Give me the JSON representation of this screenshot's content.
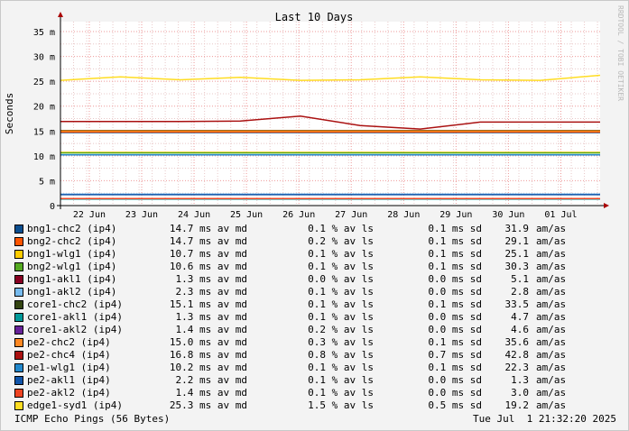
{
  "chart_data": {
    "type": "line",
    "title": "Last 10 Days",
    "ylabel": "Seconds",
    "ylim": [
      0,
      0.037
    ],
    "y_ticks": [
      {
        "value": 0,
        "label": "0"
      },
      {
        "value": 0.005,
        "label": "5 m"
      },
      {
        "value": 0.01,
        "label": "10 m"
      },
      {
        "value": 0.015,
        "label": "15 m"
      },
      {
        "value": 0.02,
        "label": "20 m"
      },
      {
        "value": 0.025,
        "label": "25 m"
      },
      {
        "value": 0.03,
        "label": "30 m"
      },
      {
        "value": 0.035,
        "label": "35 m"
      }
    ],
    "x_ticks": [
      "22 Jun",
      "23 Jun",
      "24 Jun",
      "25 Jun",
      "26 Jun",
      "27 Jun",
      "28 Jun",
      "29 Jun",
      "30 Jun",
      "01 Jul"
    ],
    "grid": true,
    "series": [
      {
        "name": "bng1-chc2 (ip4)",
        "color": "#0b4e8f",
        "median": "14.7 ms av md",
        "loss": "0.1 % av ls",
        "sd": "0.1 ms sd",
        "amas": "31.9",
        "unit": "am/as",
        "values": [
          14.7,
          14.7,
          14.7,
          14.7,
          14.7,
          14.7,
          14.7,
          14.7,
          14.7,
          14.7
        ]
      },
      {
        "name": "bng2-chc2 (ip4)",
        "color": "#ff5500",
        "median": "14.7 ms av md",
        "loss": "0.2 % av ls",
        "sd": "0.1 ms sd",
        "amas": "29.1",
        "unit": "am/as",
        "values": [
          14.8,
          14.8,
          14.8,
          14.8,
          14.8,
          14.8,
          14.8,
          14.8,
          14.8,
          14.8
        ]
      },
      {
        "name": "bng1-wlg1 (ip4)",
        "color": "#ffcc00",
        "median": "10.7 ms av md",
        "loss": "0.1 % av ls",
        "sd": "0.1 ms sd",
        "amas": "25.1",
        "unit": "am/as",
        "values": [
          10.7,
          10.7,
          10.7,
          10.7,
          10.7,
          10.7,
          10.7,
          10.7,
          10.7,
          10.7
        ]
      },
      {
        "name": "bng2-wlg1 (ip4)",
        "color": "#55aa22",
        "median": "10.6 ms av md",
        "loss": "0.1 % av ls",
        "sd": "0.1 ms sd",
        "amas": "30.3",
        "unit": "am/as",
        "values": [
          10.6,
          10.6,
          10.6,
          10.6,
          10.6,
          10.6,
          10.6,
          10.6,
          10.6,
          10.6
        ]
      },
      {
        "name": "bng1-akl1 (ip4)",
        "color": "#880022",
        "median": "1.3 ms av md",
        "loss": "0.0 % av ls",
        "sd": "0.0 ms sd",
        "amas": "5.1",
        "unit": "am/as",
        "values": [
          1.3,
          1.3,
          1.3,
          1.3,
          1.3,
          1.3,
          1.3,
          1.3,
          1.3,
          1.3
        ]
      },
      {
        "name": "bng1-akl2 (ip4)",
        "color": "#77bbee",
        "median": "2.3 ms av md",
        "loss": "0.1 % av ls",
        "sd": "0.0 ms sd",
        "amas": "2.8",
        "unit": "am/as",
        "values": [
          2.3,
          2.3,
          2.3,
          2.3,
          2.3,
          2.3,
          2.3,
          2.3,
          2.3,
          2.3
        ]
      },
      {
        "name": "core1-chc2 (ip4)",
        "color": "#334411",
        "median": "15.1 ms av md",
        "loss": "0.1 % av ls",
        "sd": "0.1 ms sd",
        "amas": "33.5",
        "unit": "am/as",
        "values": [
          15.1,
          15.1,
          15.1,
          15.1,
          15.1,
          15.1,
          15.1,
          15.1,
          15.1,
          15.1
        ]
      },
      {
        "name": "core1-akl1 (ip4)",
        "color": "#009999",
        "median": "1.3 ms av md",
        "loss": "0.1 % av ls",
        "sd": "0.0 ms sd",
        "amas": "4.7",
        "unit": "am/as",
        "values": [
          1.3,
          1.3,
          1.3,
          1.3,
          1.3,
          1.3,
          1.3,
          1.3,
          1.3,
          1.3
        ]
      },
      {
        "name": "core1-akl2 (ip4)",
        "color": "#662299",
        "median": "1.4 ms av md",
        "loss": "0.2 % av ls",
        "sd": "0.0 ms sd",
        "amas": "4.6",
        "unit": "am/as",
        "values": [
          1.4,
          1.4,
          1.4,
          1.4,
          1.4,
          1.4,
          1.4,
          1.4,
          1.4,
          1.4
        ]
      },
      {
        "name": "pe2-chc2 (ip4)",
        "color": "#ff8822",
        "median": "15.0 ms av md",
        "loss": "0.3 % av ls",
        "sd": "0.1 ms sd",
        "amas": "35.6",
        "unit": "am/as",
        "values": [
          15.0,
          15.0,
          15.0,
          15.0,
          15.0,
          15.0,
          15.0,
          15.0,
          15.0,
          15.0
        ]
      },
      {
        "name": "pe2-chc4 (ip4)",
        "color": "#aa1111",
        "median": "16.8 ms av md",
        "loss": "0.8 % av ls",
        "sd": "0.7 ms sd",
        "amas": "42.8",
        "unit": "am/as",
        "values": [
          16.9,
          16.9,
          16.9,
          17.0,
          18.0,
          16.1,
          15.4,
          16.8,
          16.8,
          16.8
        ]
      },
      {
        "name": "pe1-wlg1 (ip4)",
        "color": "#2288cc",
        "median": "10.2 ms av md",
        "loss": "0.1 % av ls",
        "sd": "0.1 ms sd",
        "amas": "22.3",
        "unit": "am/as",
        "values": [
          10.2,
          10.2,
          10.2,
          10.2,
          10.2,
          10.2,
          10.2,
          10.2,
          10.2,
          10.2
        ]
      },
      {
        "name": "pe2-akl1 (ip4)",
        "color": "#1155aa",
        "median": "2.2 ms av md",
        "loss": "0.1 % av ls",
        "sd": "0.0 ms sd",
        "amas": "1.3",
        "unit": "am/as",
        "values": [
          2.2,
          2.2,
          2.2,
          2.2,
          2.2,
          2.2,
          2.2,
          2.2,
          2.2,
          2.2
        ]
      },
      {
        "name": "pe2-akl2 (ip4)",
        "color": "#ee4422",
        "median": "1.4 ms av md",
        "loss": "0.1 % av ls",
        "sd": "0.0 ms sd",
        "amas": "3.0",
        "unit": "am/as",
        "values": [
          1.4,
          1.4,
          1.4,
          1.4,
          1.4,
          1.4,
          1.4,
          1.4,
          1.4,
          1.4
        ]
      },
      {
        "name": "edge1-syd1 (ip4)",
        "color": "#ffdd22",
        "median": "25.3 ms av md",
        "loss": "1.5 % av ls",
        "sd": "0.5 ms sd",
        "amas": "19.2",
        "unit": "am/as",
        "values": [
          25.2,
          25.9,
          25.3,
          25.8,
          25.2,
          25.3,
          25.9,
          25.3,
          25.2,
          26.2
        ]
      }
    ]
  },
  "footer": {
    "left": "ICMP Echo Pings (56 Bytes)",
    "right": "Tue Jul  1 21:32:20 2025"
  },
  "watermark": "RRDTOOL / TOBI OETIKER"
}
